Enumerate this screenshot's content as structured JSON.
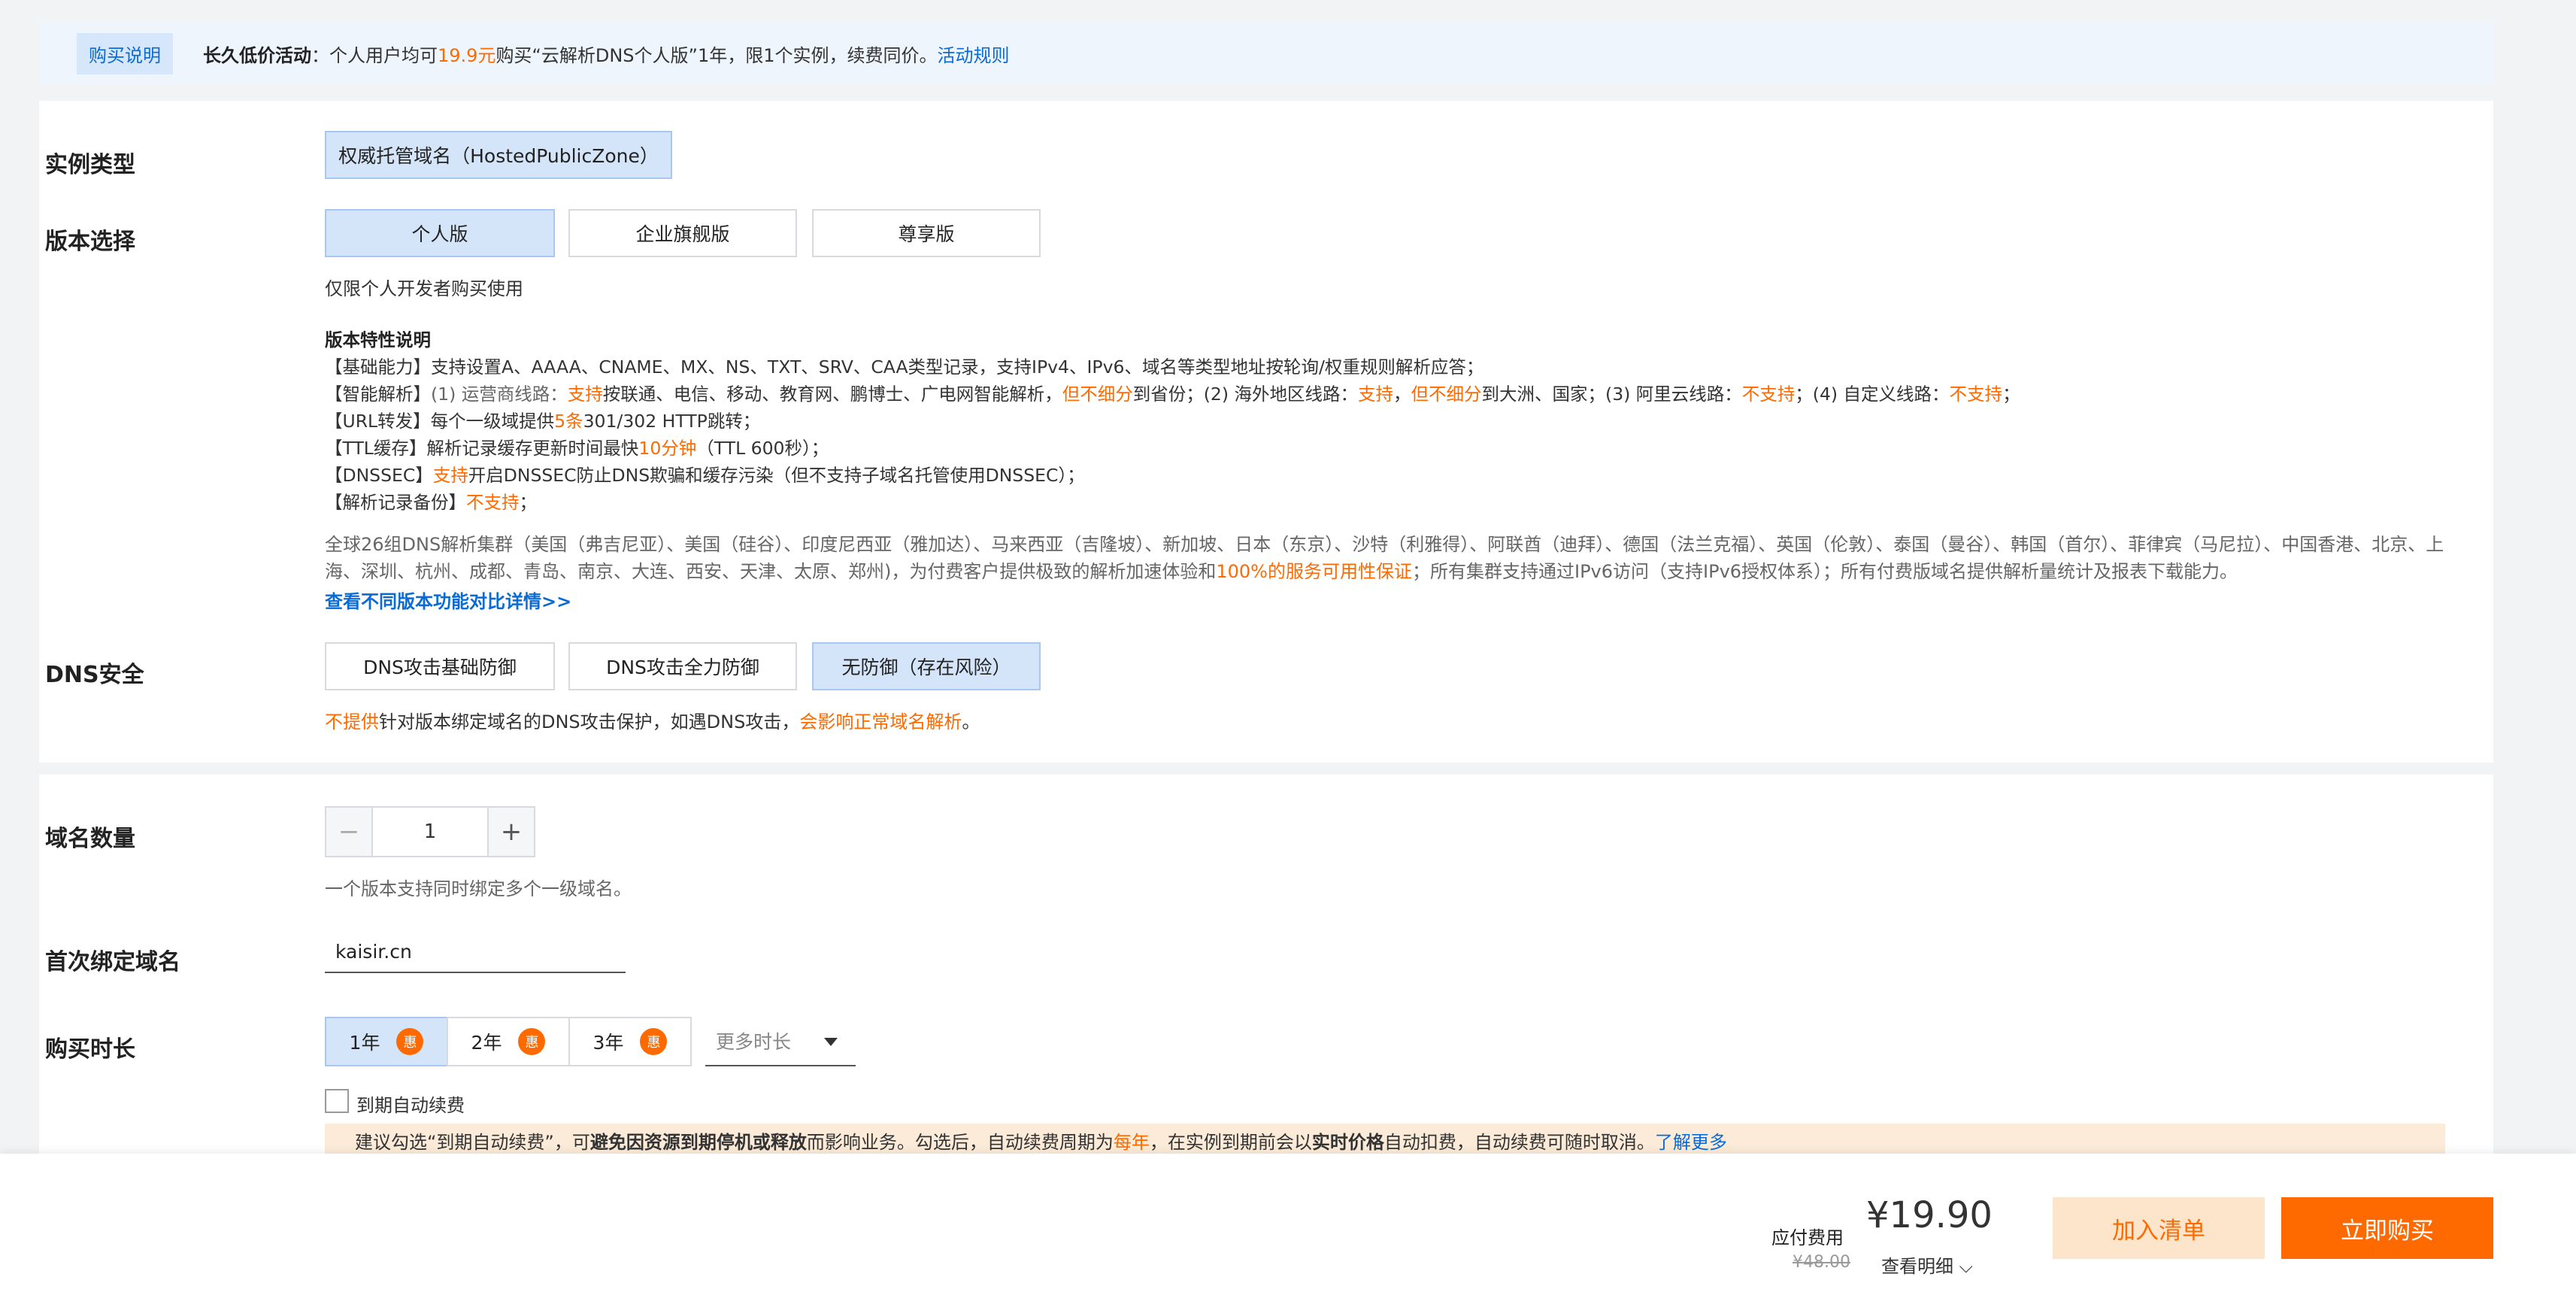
{
  "notice": {
    "tag": "购买说明",
    "title": "长久低价活动",
    "text_prefix": "：个人用户均可",
    "price": "19.9元",
    "text_suffix": "购买“云解析DNS个人版”1年，限1个实例，续费同价。",
    "rule_link": "活动规则"
  },
  "instance_type": {
    "label": "实例类型",
    "option": "权威托管域名（HostedPublicZone）"
  },
  "edition": {
    "label": "版本选择",
    "options": [
      "个人版",
      "企业旗舰版",
      "尊享版"
    ],
    "selected": "个人版",
    "warning": "仅限个人开发者购买使用",
    "feature_title": "版本特性说明",
    "features": {
      "basic_prefix": "【基础能力】",
      "basic_text": "支持设置A、AAAA、CNAME、MX、NS、TXT、SRV、CAA类型记录，支持IPv4、IPv6、域名等类型地址按轮询/权重规则解析应答；",
      "smart_prefix": "【智能解析】",
      "smart_p1": "(1) 运营商线路：",
      "smart_support1": "支持",
      "smart_p2": "按联通、电信、移动、教育网、鹏博士、广电网智能解析，",
      "smart_no_detail1": "但不细分",
      "smart_p3": "到省份；(2) 海外地区线路：",
      "smart_support2": "支持",
      "smart_p4": "，",
      "smart_no_detail2": "但不细分",
      "smart_p5": "到大洲、国家；(3) 阿里云线路：",
      "smart_unsupported1": "不支持",
      "smart_p6": "；(4) 自定义线路：",
      "smart_unsupported2": "不支持",
      "smart_p7": "；",
      "url_prefix": "【URL转发】",
      "url_p1": "每个一级域提供",
      "url_count": "5条",
      "url_p2": "301/302 HTTP跳转；",
      "ttl_prefix": "【TTL缓存】",
      "ttl_p1": "解析记录缓存更新时间最快",
      "ttl_value": "10分钟",
      "ttl_p2": "（TTL 600秒）；",
      "dnssec_prefix": "【DNSSEC】",
      "dnssec_support": "支持",
      "dnssec_p1": "开启DNSSEC防止DNS欺骗和缓存污染（但不支持子域名托管使用DNSSEC）；",
      "backup_prefix": "【解析记录备份】",
      "backup_unsupported": "不支持",
      "backup_p1": "；"
    },
    "cluster_desc_p1": "全球26组DNS解析集群（美国（弗吉尼亚）、美国（硅谷）、印度尼西亚（雅加达）、马来西亚（吉隆坡）、新加坡、日本（东京）、沙特（利雅得）、阿联酋（迪拜）、德国（法兰克福）、英国（伦敦）、泰国（曼谷）、韩国（首尔）、菲律宾（马尼拉）、中国香港、北京、上海、深圳、杭州、成都、青岛、南京、大连、西安、天津、太原、郑州)，为付费客户提供极致的解析加速体验和",
    "cluster_desc_highlight": "100%的服务可用性保证",
    "cluster_desc_p2": "；所有集群支持通过IPv6访问（支持IPv6授权体系）；所有付费版域名提供解析量统计及报表下载能力。",
    "compare_link": "查看不同版本功能对比详情>>"
  },
  "dns_security": {
    "label": "DNS安全",
    "options": [
      "DNS攻击基础防御",
      "DNS攻击全力防御",
      "无防御（存在风险）"
    ],
    "selected": "无防御（存在风险）",
    "note_p1": "不提供",
    "note_p2": "针对版本绑定域名的DNS攻击保护，如遇DNS攻击，",
    "note_p3": "会影响正常域名解析",
    "note_p4": "。"
  },
  "domain_count": {
    "label": "域名数量",
    "value": "1",
    "minus": "−",
    "plus": "+",
    "hint": "一个版本支持同时绑定多个一级域名。"
  },
  "first_domain": {
    "label": "首次绑定域名",
    "value": "kaisir.cn"
  },
  "duration": {
    "label": "购买时长",
    "options": [
      "1年",
      "2年",
      "3年"
    ],
    "badge": "惠",
    "selected": "1年",
    "more": "更多时长"
  },
  "auto_renew": {
    "label": "到期自动续费",
    "checked": false,
    "tip_p1": "建议勾选“到期自动续费”，可",
    "tip_bold1": "避免因资源到期停机或释放",
    "tip_p2": "而影响业务。勾选后，自动续费周期为",
    "tip_period": "每年",
    "tip_p3": "，在实例到期前会以",
    "tip_bold2": "实时价格",
    "tip_p4": "自动扣费，自动续费可随时取消。",
    "tip_link": "了解更多"
  },
  "footer": {
    "fee_label": "应付费用",
    "price": "¥19.90",
    "original_price": "¥48.00",
    "detail_link": "查看明细",
    "add_cart": "加入清单",
    "buy_now": "立即购买"
  },
  "colors": {
    "accent": "#ff6a00",
    "link": "#0b6bd6",
    "selected_bg": "#d5e5f9"
  }
}
